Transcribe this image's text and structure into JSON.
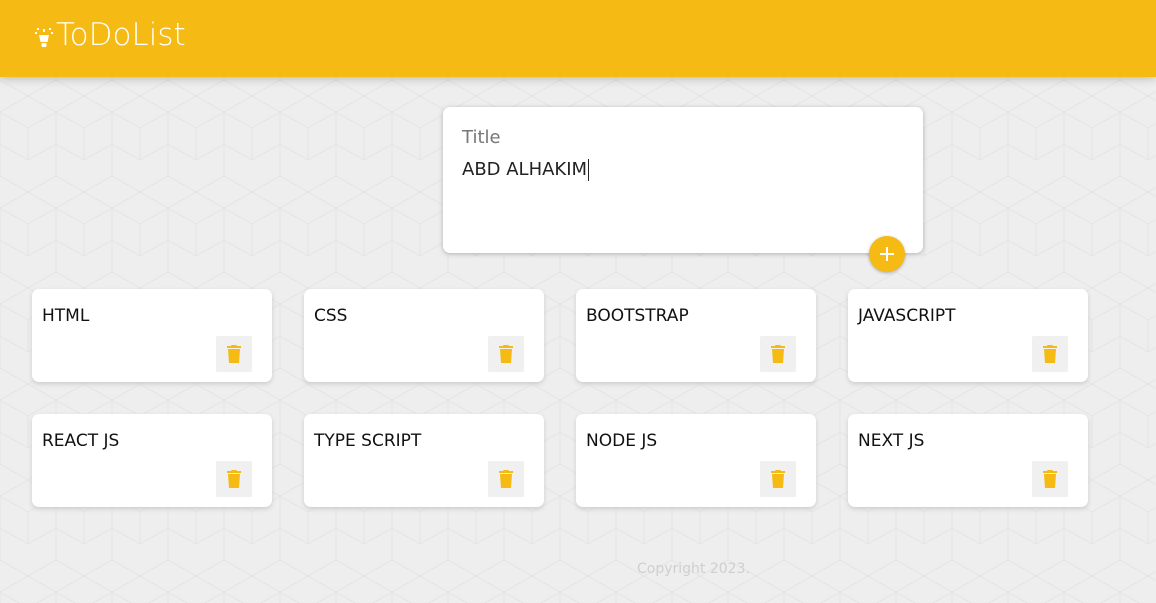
{
  "header": {
    "title": "ToDoList",
    "brand_color": "#f5ba13",
    "icon": "lightbulb-icon"
  },
  "create_note": {
    "title_placeholder": "Title",
    "content_value": "ABD ALHAKIM",
    "add_icon": "plus-icon"
  },
  "notes": [
    {
      "title": "HTML"
    },
    {
      "title": "CSS"
    },
    {
      "title": "BOOTSTRAP"
    },
    {
      "title": "JAVASCRIPT"
    },
    {
      "title": "REACT JS"
    },
    {
      "title": "TYPE SCRIPT"
    },
    {
      "title": "NODE JS"
    },
    {
      "title": "NEXT JS"
    }
  ],
  "note_delete_icon": "trash-icon",
  "footer": {
    "copyright": "Copyright 2023."
  }
}
